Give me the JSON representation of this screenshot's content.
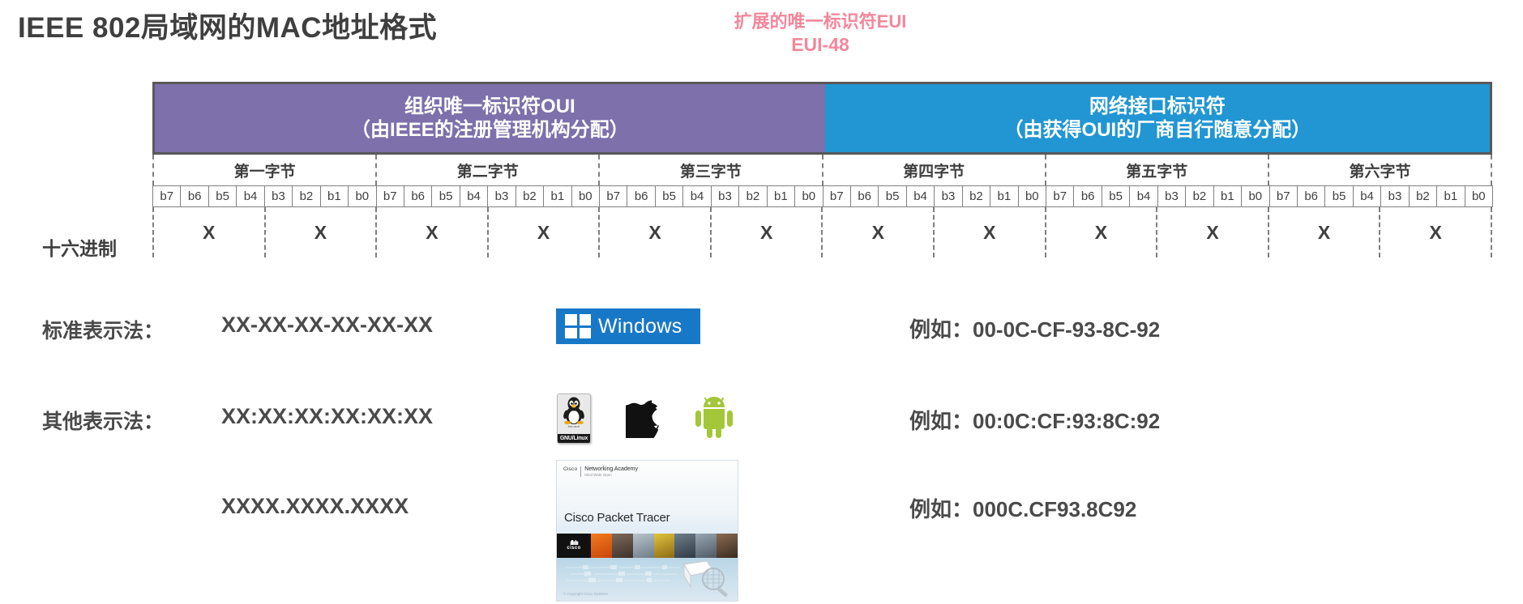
{
  "title": "IEEE 802局域网的MAC地址格式",
  "eui": {
    "line1": "扩展的唯一标识符EUI",
    "line2": "EUI-48",
    "color": "#f4879b"
  },
  "banner": {
    "oui": {
      "line1": "组织唯一标识符OUI",
      "line2": "（由IEEE的注册管理机构分配）",
      "color": "#7e70ab"
    },
    "nic": {
      "line1": "网络接口标识符",
      "line2": "（由获得OUI的厂商自行随意分配）",
      "color": "#2196d3"
    }
  },
  "grid": {
    "bytes": [
      "第一字节",
      "第二字节",
      "第三字节",
      "第四字节",
      "第五字节",
      "第六字节"
    ],
    "bits": [
      "b7",
      "b6",
      "b5",
      "b4",
      "b3",
      "b2",
      "b1",
      "b0"
    ],
    "hex_label": "十六进制",
    "hex_marks": [
      "X",
      "X",
      "X",
      "X",
      "X",
      "X",
      "X",
      "X",
      "X",
      "X",
      "X",
      "X"
    ]
  },
  "rows": {
    "standard": {
      "label": "标准表示法：",
      "value": "XX-XX-XX-XX-XX-XX",
      "example": "例如：00-0C-CF-93-8C-92"
    },
    "other": {
      "label": "其他表示法：",
      "value": "XX:XX:XX:XX:XX:XX",
      "example": "例如：00:0C:CF:93:8C:92"
    },
    "dotted": {
      "label": "",
      "value": "XXXX.XXXX.XXXX",
      "example": "例如：000C.CF93.8C92"
    }
  },
  "logos": {
    "windows": {
      "text": "Windows",
      "bg": "#1878c8"
    },
    "linux": {
      "caption": "GNU/Linux",
      "sub": "free-as-in"
    },
    "apple": {
      "name": "apple-logo"
    },
    "android": {
      "name": "android-logo",
      "color": "#a4c639"
    },
    "packet_tracer": {
      "brand": "Cisco",
      "academy_line1": "Networking Academy",
      "academy_line2": "Mind Wide Open",
      "title": "Cisco Packet Tracer",
      "logo_text": "cisco",
      "footer": "© Copyright Cisco Systems"
    }
  }
}
